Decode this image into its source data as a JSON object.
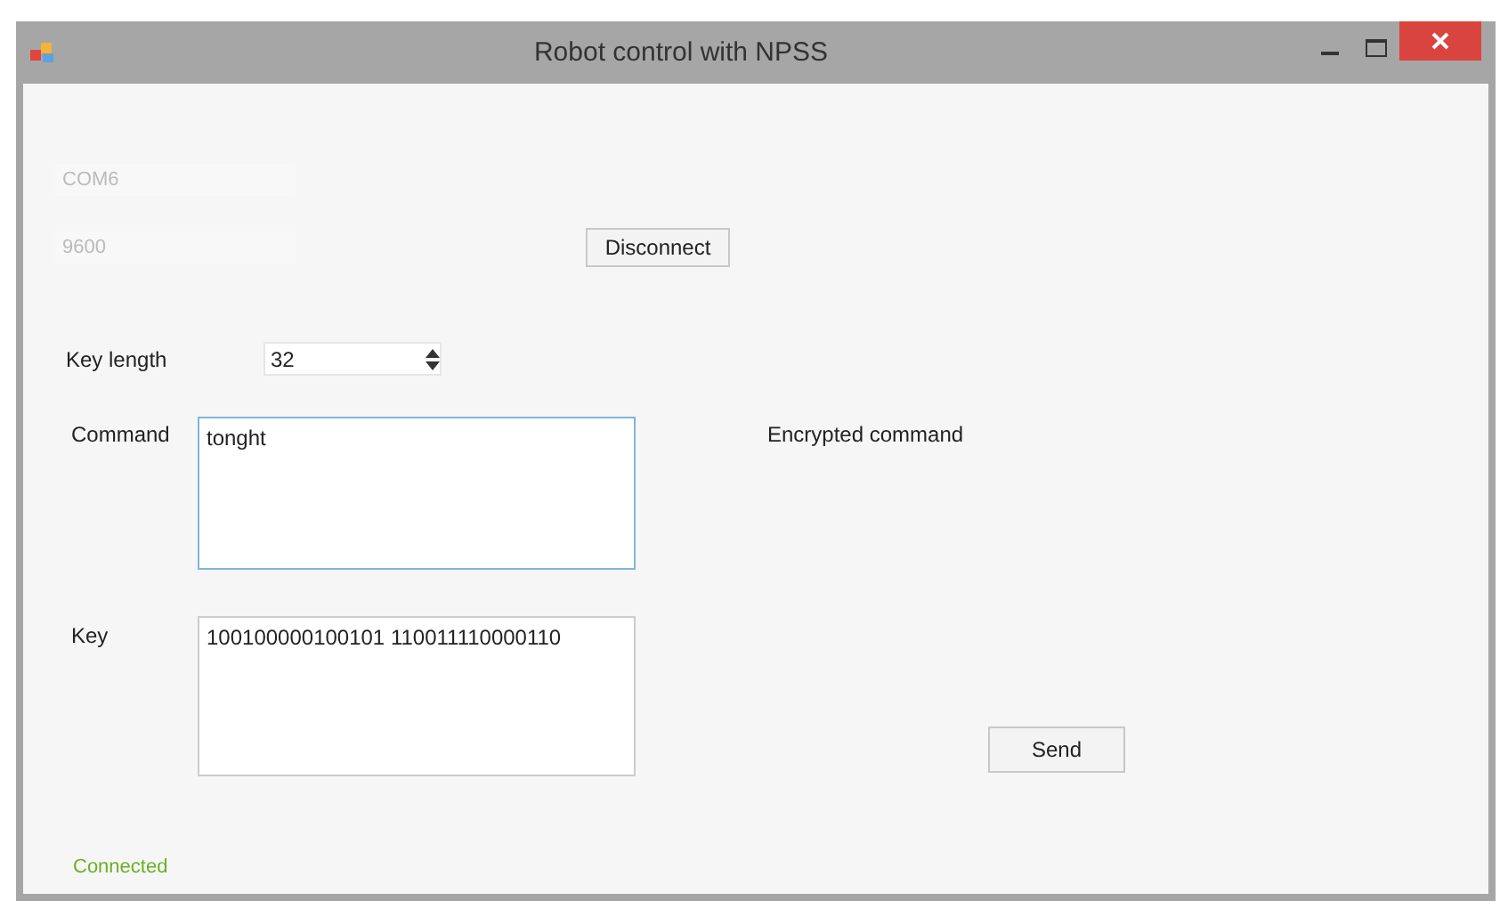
{
  "window": {
    "title": "Robot control with NPSS"
  },
  "port": {
    "value": "COM6",
    "disabled": true
  },
  "baud": {
    "value": "9600",
    "disabled": true
  },
  "disconnect_button": "Disconnect",
  "key_length": {
    "label": "Key length",
    "value": "32"
  },
  "command": {
    "label": "Command",
    "value": "tonght",
    "focused": true
  },
  "encrypted_command": {
    "label": "Encrypted command"
  },
  "key": {
    "label": "Key",
    "value": "100100000100101 110011110000110"
  },
  "send_button": "Send",
  "status": {
    "text": "Connected",
    "color": "#6ab023"
  }
}
